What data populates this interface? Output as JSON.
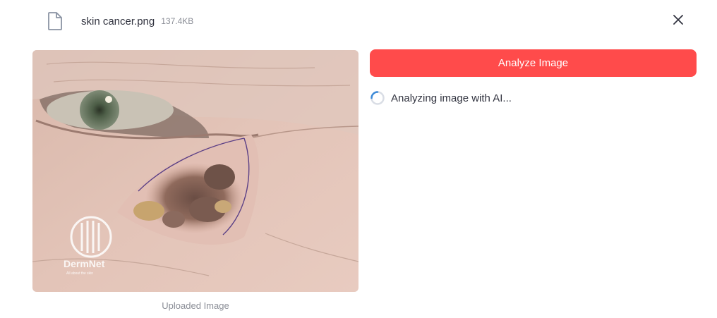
{
  "file": {
    "name": "skin cancer.png",
    "size": "137.4KB",
    "icon": "file-icon"
  },
  "close": {
    "icon": "close-icon"
  },
  "image": {
    "caption": "Uploaded Image",
    "watermark": "DermNet",
    "watermark_tagline": "All about the skin"
  },
  "actions": {
    "analyze_label": "Analyze Image",
    "accent_color": "#ff4b4b"
  },
  "status": {
    "text": "Analyzing image with AI...",
    "icon": "spinner-icon"
  }
}
